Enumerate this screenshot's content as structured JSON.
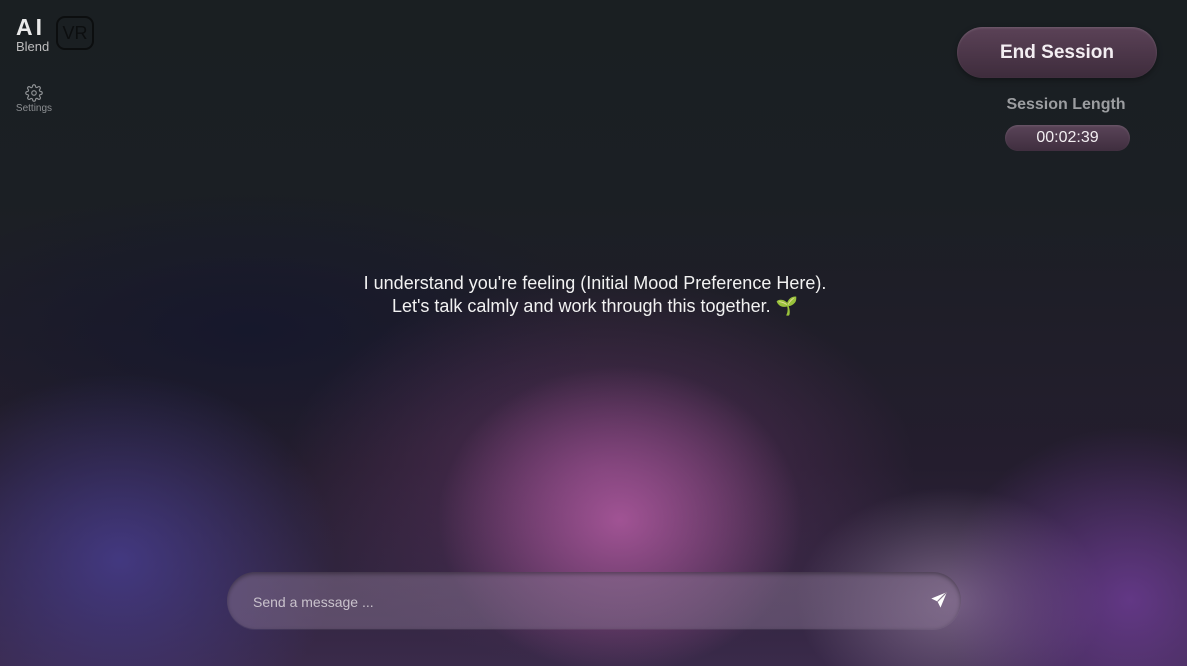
{
  "brand": {
    "logo_ai": "AI",
    "logo_blend": "Blend",
    "logo_vr": "VR"
  },
  "sidebar": {
    "settings_label": "Settings",
    "settings_icon": "gear-icon"
  },
  "header": {
    "end_session_label": "End Session",
    "session_length_label": "Session Length",
    "session_timer": "00:02:39"
  },
  "assistant": {
    "line1": "I understand you're feeling (Initial Mood Preference Here).",
    "line2": "Let's talk calmly and work through this together.",
    "emoji": "🌱"
  },
  "composer": {
    "placeholder": "Send a message ...",
    "value": "",
    "send_icon": "send-icon"
  },
  "colors": {
    "background": "#1a1f22",
    "button": "#4f3a4c",
    "accent_pink": "#b05aa0",
    "accent_purple": "#463c8c"
  }
}
